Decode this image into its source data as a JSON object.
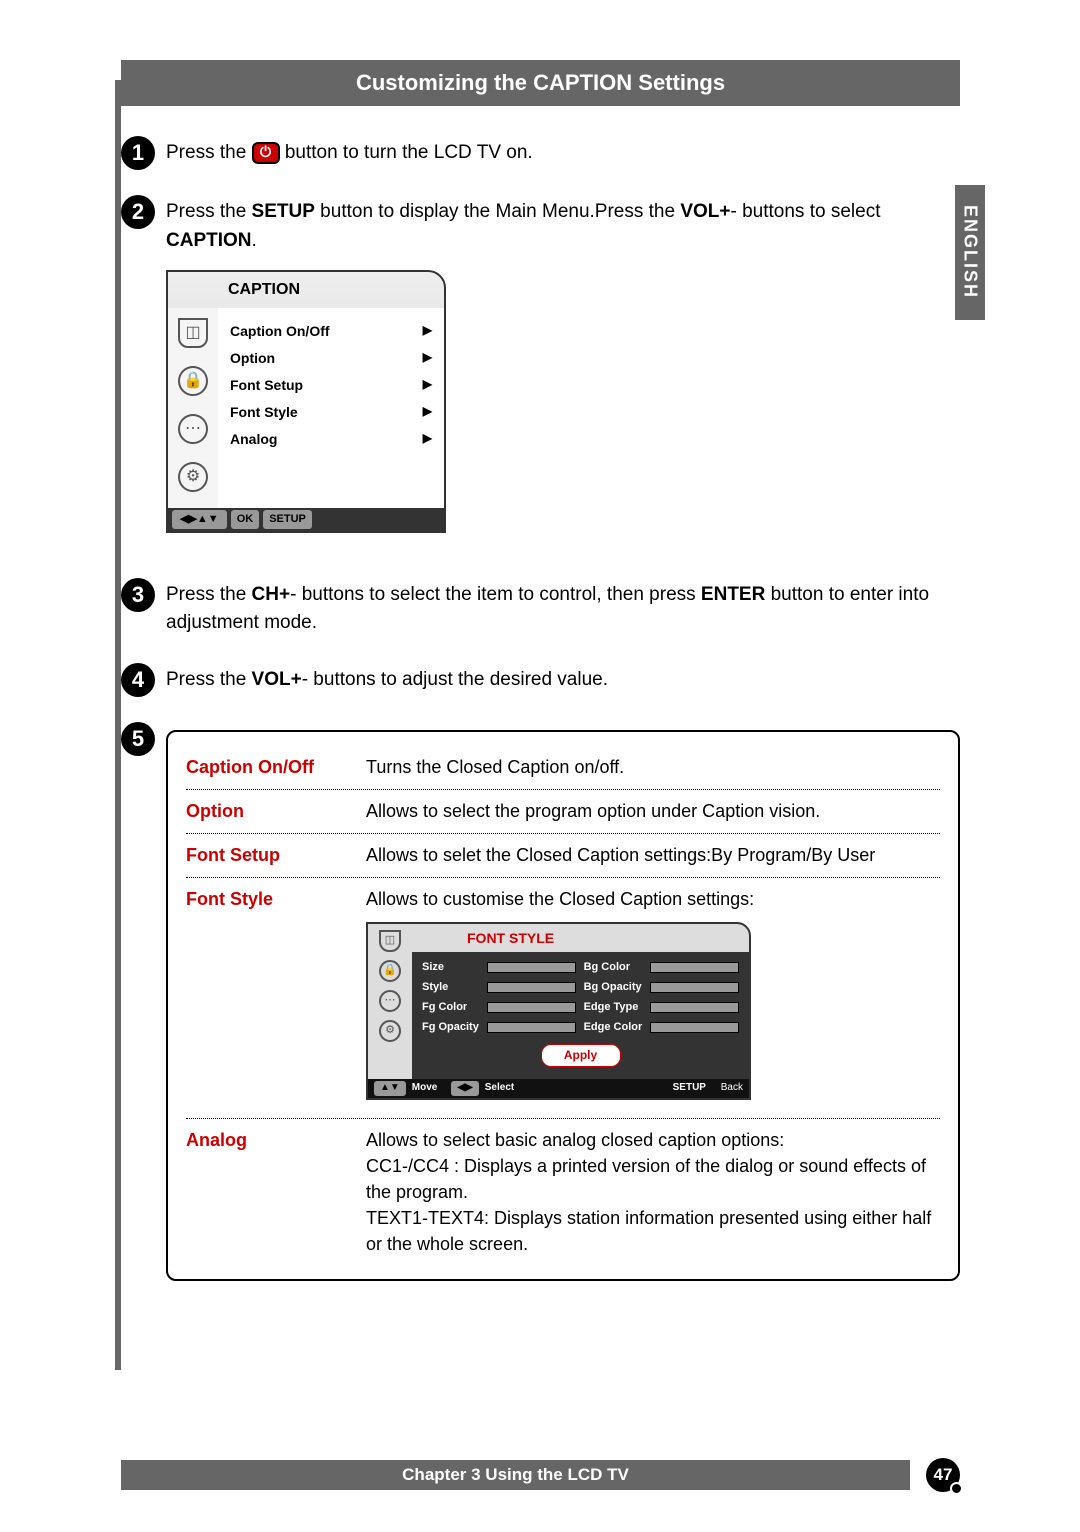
{
  "header": {
    "title": "Customizing the CAPTION Settings"
  },
  "side_tab": "ENGLISH",
  "steps": {
    "s1": {
      "num": "1",
      "text_a": "Press the ",
      "text_b": " button to turn the LCD TV on."
    },
    "s2": {
      "num": "2",
      "text_a": "Press the ",
      "bold_a": "SETUP",
      "text_b": " button to display the Main Menu.Press the ",
      "bold_b": "VOL+",
      "text_c": "- buttons to select ",
      "bold_c": "CAPTION",
      "text_d": "."
    },
    "s3": {
      "num": "3",
      "text_a": "Press the ",
      "bold_a": "CH+",
      "text_b": "- buttons to select the item to control, then press ",
      "bold_b": "ENTER",
      "text_c": " button to enter into adjustment mode."
    },
    "s4": {
      "num": "4",
      "text_a": "Press the ",
      "bold_a": "VOL+",
      "text_b": "- buttons to adjust the desired value."
    },
    "s5": {
      "num": "5"
    }
  },
  "osd1": {
    "title": "CAPTION",
    "items": [
      "Caption On/Off",
      "Option",
      "Font Setup",
      "Font Style",
      "Analog"
    ],
    "foot": {
      "arrows": "◀▶▲▼",
      "ok": "OK",
      "setup": "SETUP"
    }
  },
  "desc": {
    "r1": {
      "label": "Caption On/Off",
      "text": "Turns the Closed Caption on/off."
    },
    "r2": {
      "label": "Option",
      "text": "Allows to select the program option under Caption vision."
    },
    "r3": {
      "label": "Font Setup",
      "text": "Allows to selet the Closed Caption settings:By Program/By User"
    },
    "r4": {
      "label": "Font Style",
      "text": "Allows to customise the Closed Caption settings:"
    },
    "r5": {
      "label": "Analog",
      "text": "Allows to select basic analog closed caption options:\nCC1-/CC4 : Displays a printed version of the dialog or sound effects of the program.\nTEXT1-TEXT4: Displays station information presented using either half or the whole screen."
    }
  },
  "osd2": {
    "title": "FONT STYLE",
    "labels": {
      "size": "Size",
      "style": "Style",
      "fgcolor": "Fg Color",
      "fgopacity": "Fg Opacity",
      "bgcolor": "Bg Color",
      "bgopacity": "Bg Opacity",
      "edgetype": "Edge Type",
      "edgecolor": "Edge Color"
    },
    "apply": "Apply",
    "foot": {
      "ud": "▲▼",
      "move": "Move",
      "lr": "◀▶",
      "select": "Select",
      "setup": "SETUP",
      "back": "Back"
    }
  },
  "footer": {
    "chapter": "Chapter 3 Using the LCD TV",
    "page": "47"
  }
}
